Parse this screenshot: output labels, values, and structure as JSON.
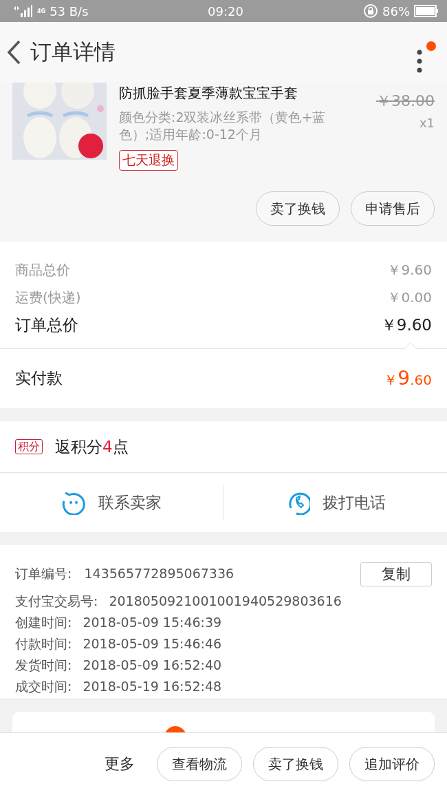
{
  "status_bar": {
    "network": "4G",
    "speed": "53 B/s",
    "time": "09:20",
    "battery": "86%"
  },
  "header": {
    "title": "订单详情",
    "menu_badge": true
  },
  "product": {
    "title": "防抓脸手套夏季薄款宝宝手套",
    "sku": "颜色分类:2双装冰丝系带（黄色+蓝色）;适用年龄:0-12个月",
    "original_price": "￥38.00",
    "quantity": "x1",
    "tag": "七天退换",
    "buttons": [
      "卖了换钱",
      "申请售后"
    ]
  },
  "prices": {
    "rows": [
      {
        "label": "商品总价",
        "value": "￥9.60",
        "kind": "minor"
      },
      {
        "label": "运费(快递)",
        "value": "￥0.00",
        "kind": "minor"
      },
      {
        "label": "订单总价",
        "value": "￥9.60",
        "kind": "major"
      }
    ],
    "paid": {
      "label": "实付款",
      "currency": "￥",
      "amount": "9",
      "cents": ".60"
    }
  },
  "points": {
    "badge": "积分",
    "text": "返积分**4**点"
  },
  "contact": [
    {
      "label": "联系卖家",
      "kind": "chat"
    },
    {
      "label": "拨打电话",
      "kind": "phone"
    }
  ],
  "info": {
    "order_no_label": "订单编号:",
    "order_no": "143565772895067336",
    "copy": "复制",
    "rows": [
      {
        "label": "支付宝交易号:",
        "value": "2018050921001001940529803616"
      },
      {
        "label": "创建时间:",
        "value": "2018-05-09 15:46:39"
      },
      {
        "label": "付款时间:",
        "value": "2018-05-09 15:46:46"
      },
      {
        "label": "发货时间:",
        "value": "2018-05-09 16:52:40"
      },
      {
        "label": "成交时间:",
        "value": "2018-05-19 16:52:48"
      }
    ]
  },
  "bottom_bar": {
    "more": "更多",
    "buttons": [
      "查看物流",
      "卖了换钱",
      "追加评价"
    ]
  }
}
